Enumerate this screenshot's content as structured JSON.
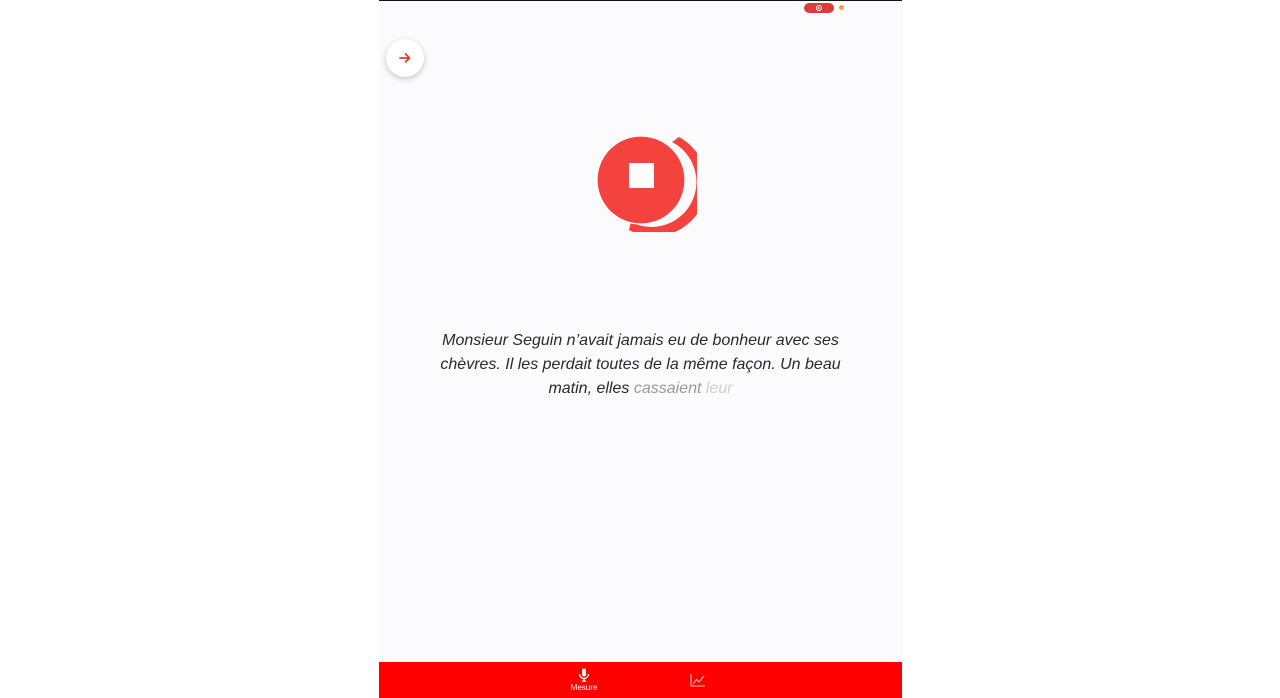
{
  "status_bar": {
    "recording_indicator": "record-pill-icon",
    "mic_in_use_indicator": "orange-dot-icon"
  },
  "toolbar": {
    "next_icon": "arrow-right-icon"
  },
  "record": {
    "state": "recording",
    "stop_icon": "stop-icon",
    "accent_color": "#f4433e",
    "progress_fraction": 0.3
  },
  "transcript": {
    "spoken": "Monsieur Seguin n’avait jamais eu de bonheur avec ses chèvres. Il les perdait toutes de la même façon. Un beau matin, elles",
    "current_word": "cassaient",
    "upcoming_word": "leur"
  },
  "tabbar": {
    "background_color": "#ff0000",
    "tabs": [
      {
        "label": "Mesure",
        "icon": "microphone-icon",
        "active": true
      },
      {
        "label": "",
        "icon": "line-chart-icon",
        "active": false
      }
    ]
  }
}
